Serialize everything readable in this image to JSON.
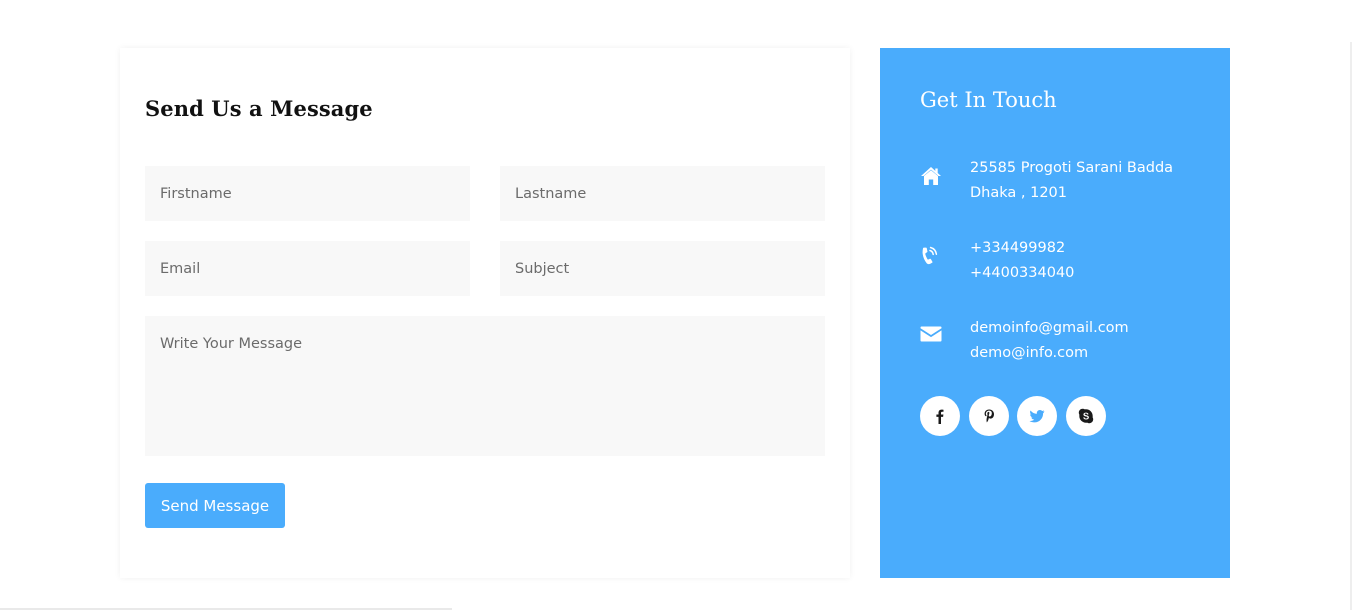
{
  "form": {
    "title": "Send Us a Message",
    "firstname_placeholder": "Firstname",
    "lastname_placeholder": "Lastname",
    "email_placeholder": "Email",
    "subject_placeholder": "Subject",
    "message_placeholder": "Write Your Message",
    "submit_label": "Send Message"
  },
  "contact": {
    "title": "Get In Touch",
    "address": {
      "icon": "home-icon",
      "line1": "25585 Progoti Sarani Badda",
      "line2": "Dhaka , 1201"
    },
    "phone": {
      "icon": "phone-icon",
      "line1": "+334499982",
      "line2": "+4400334040"
    },
    "email": {
      "icon": "envelope-icon",
      "line1": "demoinfo@gmail.com",
      "line2": "demo@info.com"
    },
    "socials": [
      {
        "icon": "facebook-icon"
      },
      {
        "icon": "pinterest-icon"
      },
      {
        "icon": "twitter-icon"
      },
      {
        "icon": "skype-icon"
      }
    ]
  },
  "colors": {
    "accent": "#4aacfc",
    "field_bg": "#f8f8f8",
    "title_text": "#111111"
  }
}
